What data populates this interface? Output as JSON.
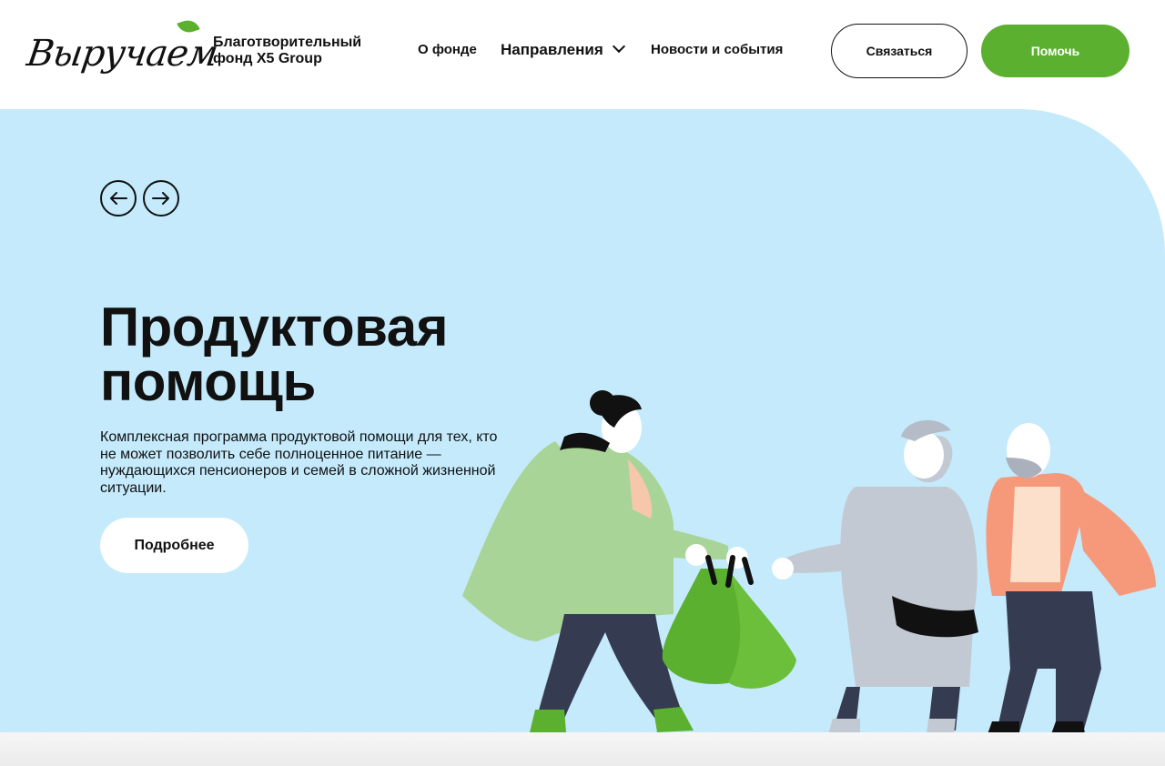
{
  "header": {
    "logo_text": "Выручаем",
    "org_name": "Благотворительный фонд X5 Group",
    "nav": {
      "about": "О фонде",
      "directions": "Направления",
      "news": "Новости и события"
    },
    "contact_label": "Связаться",
    "help_label": "Помочь"
  },
  "hero": {
    "title": "Продуктовая помощь",
    "description": "Комплексная программа продуктовой помощи для тех, кто не может позволить себе полноценное питание — нуждающихся пенсионеров и семей в сложной жизненной ситуации.",
    "more_label": "Подробнее"
  },
  "icons": {
    "prev": "arrow-left-icon",
    "next": "arrow-right-icon",
    "nav_dropdown": "chevron-down-icon"
  },
  "colors": {
    "brand_green": "#5cb030",
    "hero_background": "#c4eafb",
    "text": "#111111"
  }
}
